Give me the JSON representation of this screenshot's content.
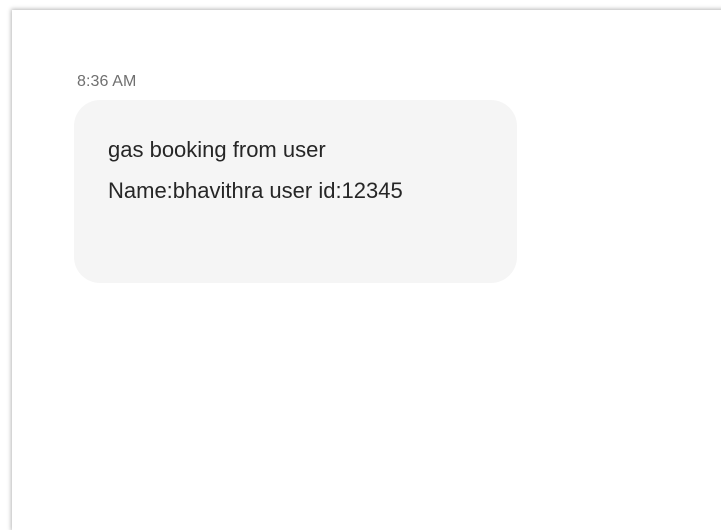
{
  "message": {
    "timestamp": "8:36 AM",
    "lines": [
      "gas booking from user",
      "Name:bhavithra user id:12345"
    ]
  }
}
